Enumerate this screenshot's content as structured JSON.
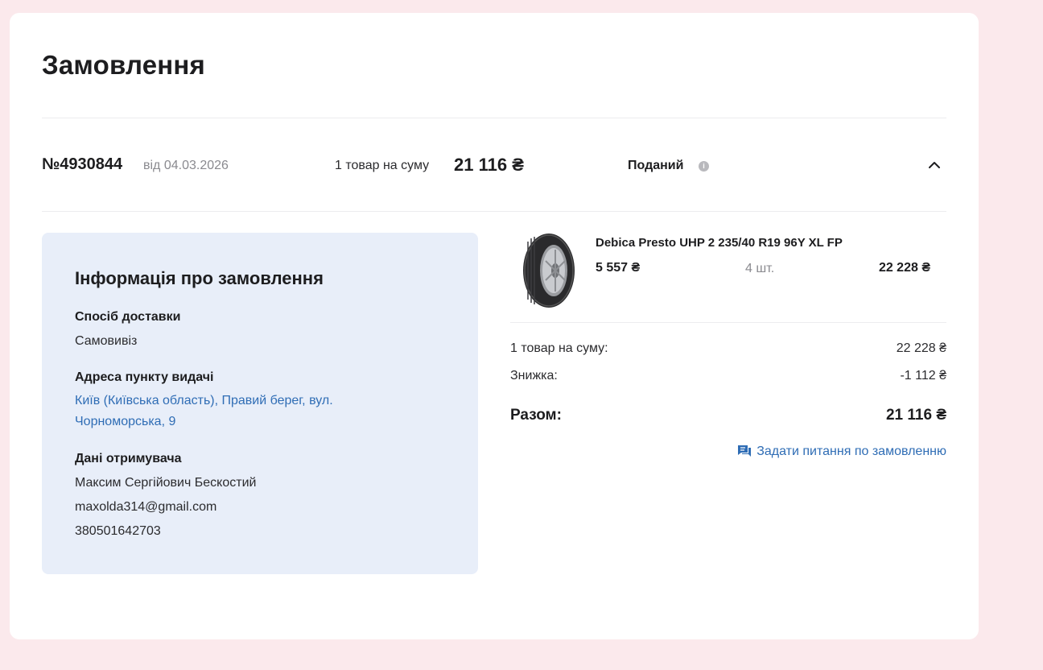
{
  "page": {
    "title": "Замовлення"
  },
  "order": {
    "number": "№4930844",
    "date": "від 04.03.2026",
    "summary_text": "1 товар на суму",
    "summary_sum": "21 116 ₴",
    "status": "Поданий",
    "status_info_icon": "info-icon",
    "toggle_icon": "chevron-up-icon"
  },
  "info": {
    "title": "Інформація про замовлення",
    "delivery_label": "Спосіб доставки",
    "delivery_value": "Самовивіз",
    "address_label": "Адреса пункту видачі",
    "address_value": "Київ (Київська область), Правий берег, вул. Чорноморська, 9",
    "recipient_label": "Дані отримувача",
    "recipient_name": "Максим Сергійович Бескостий",
    "recipient_email": "maxolda314@gmail.com",
    "recipient_phone": "380501642703"
  },
  "product": {
    "name": "Debica Presto UHP 2 235/40 R19 96Y XL FP",
    "price": "5 557 ₴",
    "qty": "4 шт.",
    "total": "22 228 ₴"
  },
  "totals": {
    "items_label": "1 товар на суму:",
    "items_value": "22 228 ₴",
    "discount_label": "Знижка:",
    "discount_value": "-1 112 ₴",
    "grand_label": "Разом:",
    "grand_value": "21 116 ₴"
  },
  "ask_link": {
    "label": "Задати питання по замовленню",
    "icon": "chat-icon"
  },
  "colors": {
    "background": "#fbe9ec",
    "panel": "#e8eef9",
    "link": "#2f6db5"
  }
}
